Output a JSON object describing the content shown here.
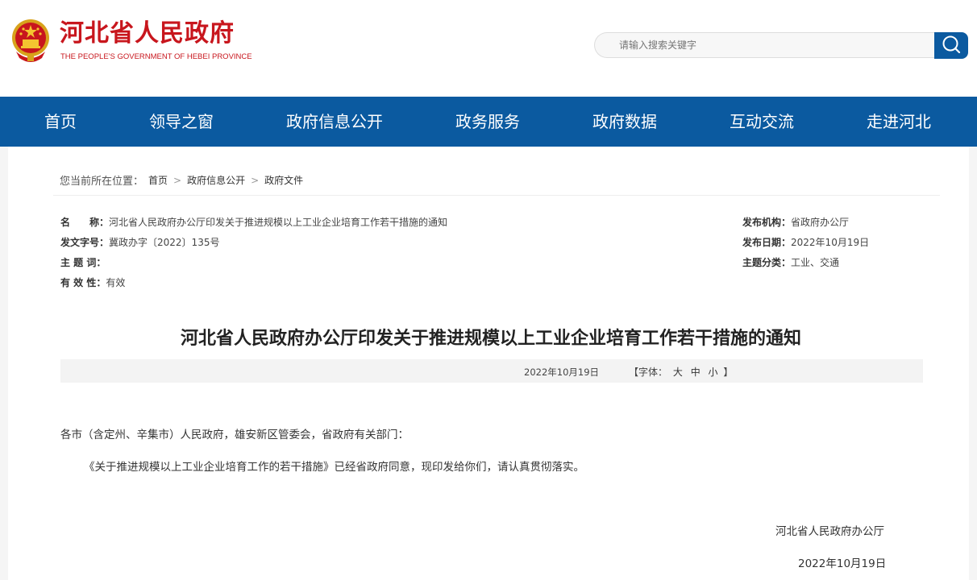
{
  "header": {
    "site_title": "河北省人民政府",
    "site_subtitle": "THE PEOPLE'S GOVERNMENT OF HEBEI PROVINCE",
    "search_placeholder": "请输入搜索关键字",
    "logo_icon": "national-emblem-icon",
    "search_icon": "magnifier-icon",
    "colors": {
      "brand_red": "#c8161d",
      "nav_blue": "#0b5aa0"
    }
  },
  "nav": {
    "items": [
      "首页",
      "领导之窗",
      "政府信息公开",
      "政务服务",
      "政府数据",
      "互动交流",
      "走进河北"
    ]
  },
  "breadcrumb": {
    "label": "您当前所在位置：",
    "items": [
      "首页",
      "政府信息公开",
      "政府文件"
    ]
  },
  "meta": {
    "name_label": "名　　称：",
    "name_value": "河北省人民政府办公厅印发关于推进规模以上工业企业培育工作若干措施的通知",
    "doc_no_label": "发文字号：",
    "doc_no_value": "冀政办字〔2022〕135号",
    "keywords_label": "主 题 词：",
    "keywords_value": "",
    "validity_label": "有 效 性：",
    "validity_value": "有效",
    "issuer_label": "发布机构：",
    "issuer_value": "省政府办公厅",
    "date_label": "发布日期：",
    "date_value": "2022年10月19日",
    "category_label": "主题分类：",
    "category_value": "工业、交通"
  },
  "article": {
    "title": "河北省人民政府办公厅印发关于推进规模以上工业企业培育工作若干措施的通知",
    "info_date": "2022年10月19日",
    "font_label_open": "【字体：",
    "font_large": "大",
    "font_medium": "中",
    "font_small": "小",
    "font_label_close": "】",
    "salutation": "各市（含定州、辛集市）人民政府，雄安新区管委会，省政府有关部门：",
    "body": "《关于推进规模以上工业企业培育工作的若干措施》已经省政府同意，现印发给你们，请认真贯彻落实。",
    "signature": "河北省人民政府办公厅",
    "signature_date": "2022年10月19日"
  }
}
